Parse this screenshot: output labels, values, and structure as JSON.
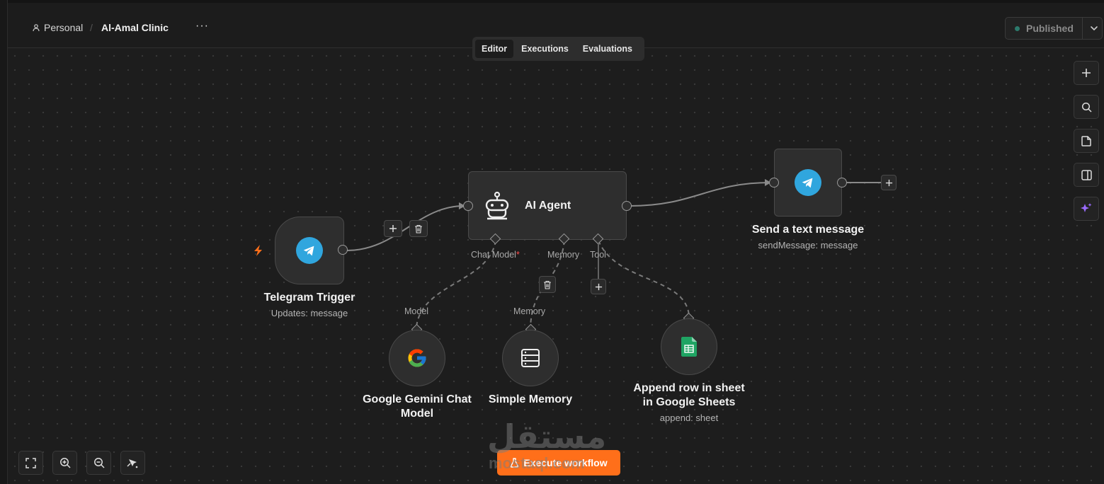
{
  "header": {
    "breadcrumb": {
      "personal": "Personal",
      "separator": "/",
      "project": "Al-Amal Clinic"
    },
    "more": "···",
    "published_label": "Published"
  },
  "tabs": [
    {
      "label": "Editor",
      "active": true
    },
    {
      "label": "Executions",
      "active": false
    },
    {
      "label": "Evaluations",
      "active": false
    }
  ],
  "right_toolbar": [
    "plus-icon",
    "search-icon",
    "sticky-note-icon",
    "panel-icon",
    "sparkle-icon"
  ],
  "bottom_toolbar": [
    "fit-view-icon",
    "zoom-in-icon",
    "zoom-out-icon",
    "tidy-up-icon"
  ],
  "nodes": {
    "telegram_trigger": {
      "title": "Telegram Trigger",
      "subtitle": "Updates: message"
    },
    "ai_agent": {
      "title": "AI Agent",
      "ports": {
        "chat_model": "Chat Model",
        "required_mark": "*",
        "memory": "Memory",
        "tool": "Tool"
      }
    },
    "send_message": {
      "title": "Send a text message",
      "subtitle": "sendMessage: message"
    },
    "gemini": {
      "title_line1": "Google Gemini Chat",
      "title_line2": "Model",
      "port": "Model"
    },
    "memory": {
      "title": "Simple Memory",
      "port": "Memory"
    },
    "sheets": {
      "title_line1": "Append row in sheet",
      "title_line2": "in Google Sheets",
      "subtitle": "append: sheet"
    }
  },
  "execute_label": "Execute workflow",
  "watermark": {
    "arabic": "مستقل",
    "latin": "mostaql.com"
  },
  "colors": {
    "accent": "#ff6f1a",
    "telegram": "#30a6de",
    "sheets": "#1fa463",
    "sparkle": "#9b6cff"
  }
}
